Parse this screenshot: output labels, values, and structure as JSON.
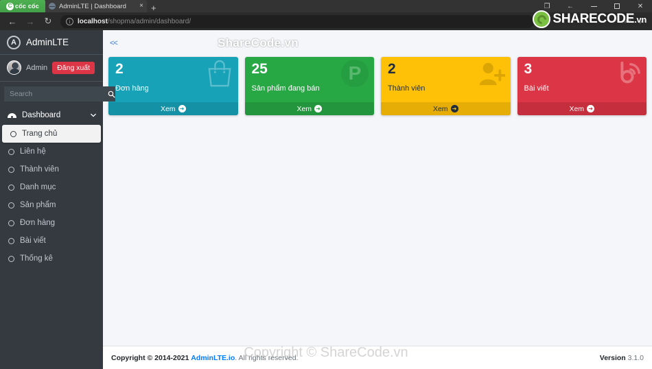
{
  "browser": {
    "app_tab_label": "cốc cốc",
    "page_tab_title": "AdminLTE | Dashboard",
    "tab_close": "×",
    "new_tab": "+",
    "back_icon": "←",
    "forward_icon": "→",
    "reload_icon": "↻",
    "url_host": "localhost",
    "url_path": "/shopma/admin/dashboard/",
    "info_icon": "i",
    "toolbar_icon_1": "✂",
    "toolbar_icon_2": "↗",
    "window_restore_icon": "❐",
    "window_back_icon": "←",
    "window_min_icon": "—",
    "window_max_icon": "□",
    "window_close_icon": "✕",
    "logo_text": "SHARECODE",
    "logo_suffix": ".vn"
  },
  "sidebar": {
    "brand": "AdminLTE",
    "brand_initial": "A",
    "user": {
      "name": "Admin",
      "logout_label": "Đăng xuất"
    },
    "search": {
      "placeholder": "Search",
      "button_icon": "🔍"
    },
    "menu": {
      "header_label": "Dashboard",
      "chevron": "⌄",
      "items": [
        {
          "label": "Trang chủ",
          "active": true
        },
        {
          "label": "Liên hệ",
          "active": false
        },
        {
          "label": "Thành viên",
          "active": false
        },
        {
          "label": "Danh mục",
          "active": false
        },
        {
          "label": "Sản phẩm",
          "active": false
        },
        {
          "label": "Đơn hàng",
          "active": false
        },
        {
          "label": "Bài viết",
          "active": false
        },
        {
          "label": "Thống kê",
          "active": false
        }
      ]
    }
  },
  "content": {
    "collapse_link": "<<",
    "watermark_top": "ShareCode.vn",
    "watermark_bottom": "Copyright © ShareCode.vn",
    "boxes": [
      {
        "number": "2",
        "label": "Đơn hàng",
        "action": "Xem",
        "color": "#17a2b8",
        "icon": "shopping-bag-icon"
      },
      {
        "number": "25",
        "label": "Sản phẩm đang bán",
        "action": "Xem",
        "color": "#28a745",
        "icon": "product-p-icon"
      },
      {
        "number": "2",
        "label": "Thành viên",
        "action": "Xem",
        "color": "#ffc107",
        "icon": "user-plus-icon"
      },
      {
        "number": "3",
        "label": "Bài viết",
        "action": "Xem",
        "color": "#dc3545",
        "icon": "blog-rss-icon"
      }
    ]
  },
  "footer": {
    "copyright_prefix": "Copyright © 2014-2021",
    "brand_link": "AdminLTE.io",
    "rights": ". All rights reserved.",
    "version_label": "Version",
    "version_number": "3.1.0"
  }
}
